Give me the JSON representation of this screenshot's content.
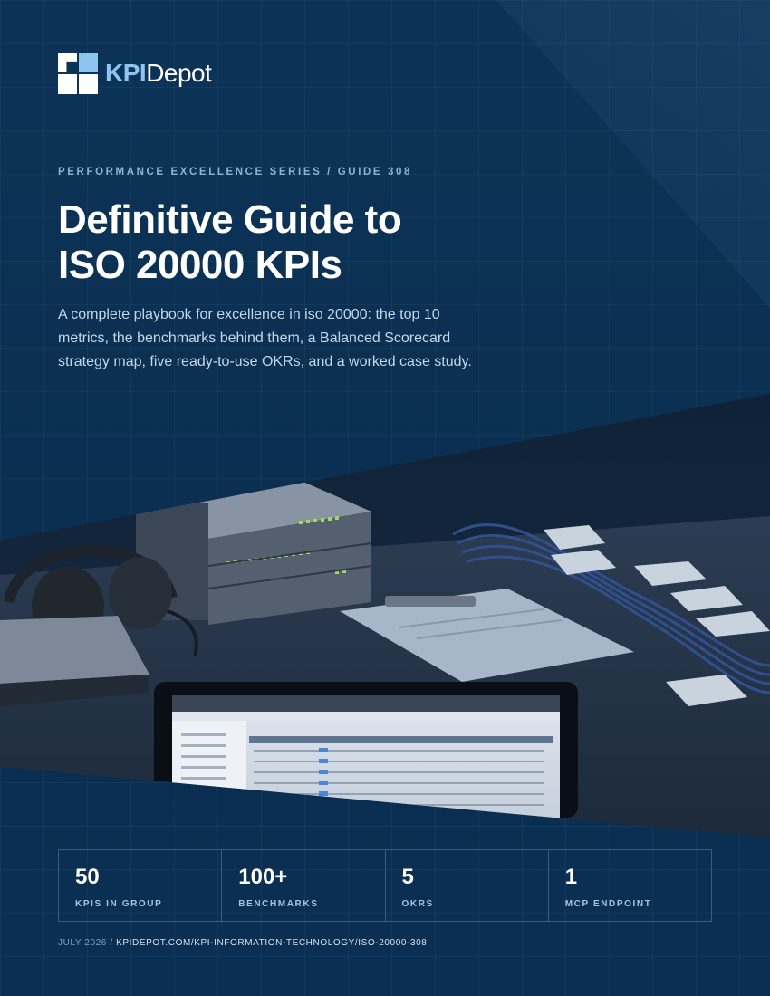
{
  "brand": {
    "name_bold": "KPI",
    "name_rest": "Depot"
  },
  "header": {
    "series": "PERFORMANCE EXCELLENCE SERIES / GUIDE 308"
  },
  "title": {
    "line1": "Definitive Guide to",
    "line2": "ISO 20000 KPIs"
  },
  "description": "A complete playbook for excellence in iso 20000: the top 10 metrics, the benchmarks behind them, a Balanced Scorecard strategy map, five ready-to-use OKRs, and a worked case study.",
  "stats": [
    {
      "value": "50",
      "label": "KPIS IN GROUP"
    },
    {
      "value": "100+",
      "label": "BENCHMARKS"
    },
    {
      "value": "5",
      "label": "OKRS"
    },
    {
      "value": "1",
      "label": "MCP ENDPOINT"
    }
  ],
  "footer": {
    "date": "JULY 2026",
    "separator": " / ",
    "url": "KPIDEPOT.COM/KPI-INFORMATION-TECHNOLOGY/ISO-20000-308"
  },
  "colors": {
    "background": "#0b2f52",
    "accent": "#8ec4f0",
    "text": "#ffffff"
  }
}
